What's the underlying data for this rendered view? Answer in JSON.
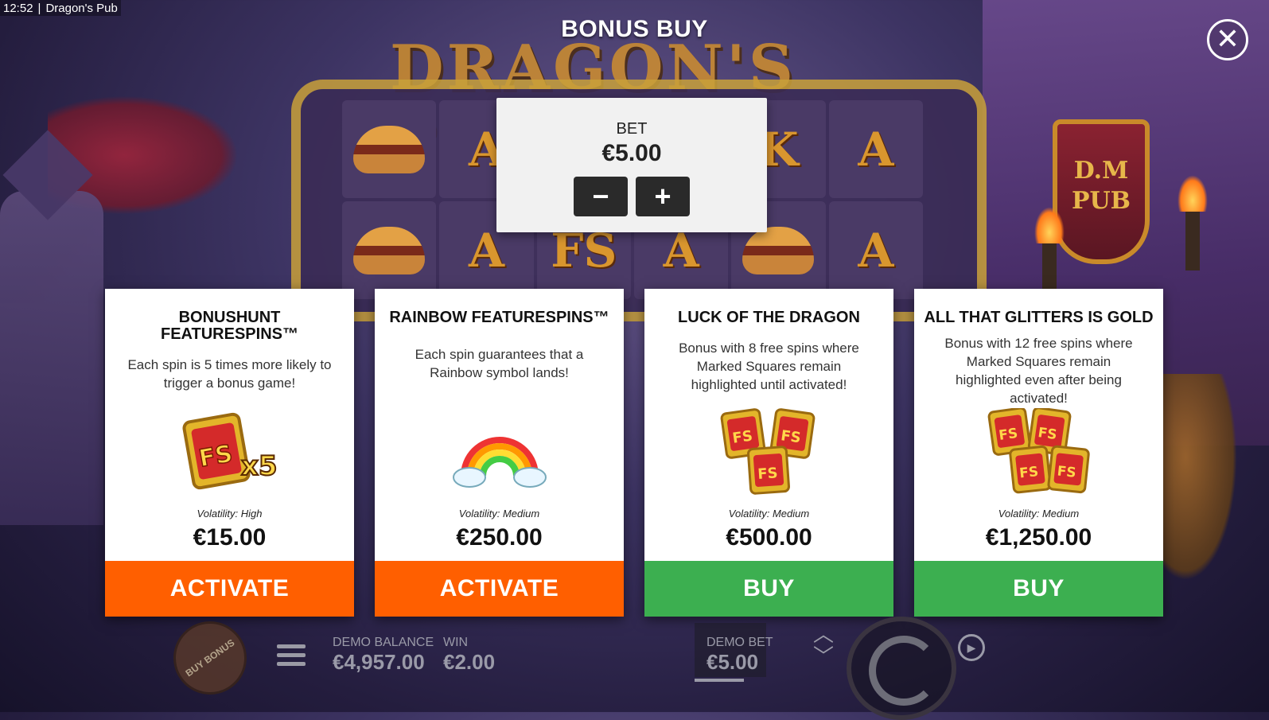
{
  "topbar": {
    "time": "12:52",
    "separator": "|",
    "app_title": "Dragon's Pub"
  },
  "background": {
    "logo_text": "DRAGON'S PUB",
    "sign_text": "D.M PUB",
    "reel_symbols": [
      "burger",
      "A",
      "",
      "",
      "K",
      "A",
      "burger",
      "A",
      "FS",
      "A",
      "burger",
      "A"
    ]
  },
  "dialog": {
    "title": "BONUS BUY",
    "close_symbol": "✕",
    "bet": {
      "label": "BET",
      "value": "€5.00",
      "minus": "−",
      "plus": "+"
    }
  },
  "cards": [
    {
      "title": "BONUSHUNT FEATURESPINS™",
      "description": "Each spin is 5 times more likely to trigger a bonus game!",
      "image": "fs-x5-icon",
      "image_text": "FS",
      "image_multiplier": "x5",
      "volatility": "Volatility: High",
      "price": "€15.00",
      "button": "ACTIVATE",
      "button_color": "#ff5f00"
    },
    {
      "title": "RAINBOW FEATURESPINS™",
      "description": "Each spin guarantees that a Rainbow symbol lands!",
      "image": "rainbow-icon",
      "volatility": "Volatility: Medium",
      "price": "€250.00",
      "button": "ACTIVATE",
      "button_color": "#ff5f00"
    },
    {
      "title": "LUCK OF THE DRAGON",
      "description": "Bonus with 8 free spins where Marked Squares remain highlighted until activated!",
      "image": "fs-x3-icon",
      "image_text": "FS",
      "volatility": "Volatility: Medium",
      "price": "€500.00",
      "button": "BUY",
      "button_color": "#3caf50"
    },
    {
      "title": "ALL THAT GLITTERS IS GOLD",
      "description": "Bonus with 12 free spins where Marked Squares remain highlighted even after being activated!",
      "image": "fs-x4-icon",
      "image_text": "FS",
      "volatility": "Volatility: Medium",
      "price": "€1,250.00",
      "button": "BUY",
      "button_color": "#3caf50"
    }
  ],
  "bottombar": {
    "buy_bonus": "BUY BONUS",
    "demo_balance_label": "DEMO BALANCE",
    "demo_balance_value": "€4,957.00",
    "win_label": "WIN",
    "win_value": "€2.00",
    "demo_bet_label": "DEMO BET",
    "demo_bet_value": "€5.00",
    "arrow_up": "︿",
    "arrow_down": "﹀",
    "auto_symbol": "▶"
  }
}
